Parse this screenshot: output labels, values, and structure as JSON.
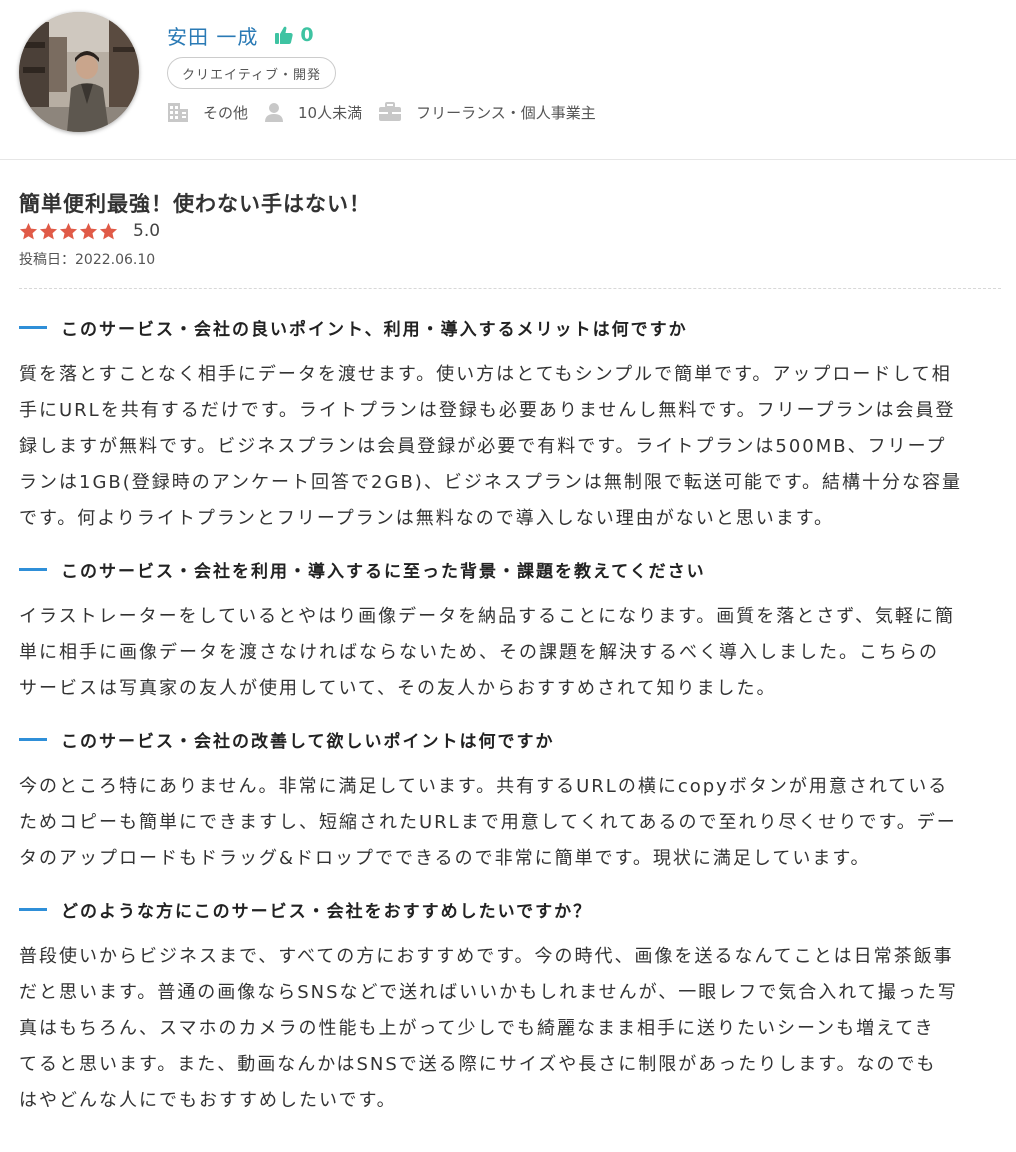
{
  "profile": {
    "name": "安田 一成",
    "like_count": "0",
    "tag": "クリエイティブ・開発",
    "industry": "その他",
    "company_size": "10人未満",
    "occupation": "フリーランス・個人事業主",
    "icons": {
      "like": "thumbs-up-icon",
      "industry": "building-icon",
      "size": "person-icon",
      "occupation": "briefcase-icon"
    },
    "colors": {
      "name": "#2a7ab5",
      "like": "#3ec3a2"
    }
  },
  "review": {
    "title": "簡単便利最強！使わない手はない！",
    "rating_value": "5.0",
    "rating": 5,
    "rating_max": 5,
    "star_color": "#e05a47",
    "post_date": "投稿日：2022.06.10",
    "accent_color": "#2f8fd8",
    "sections": [
      {
        "heading": "このサービス・会社の良いポイント、利用・導入するメリットは何ですか",
        "lines": [
          "質を落とすことなく相手にデータを渡せます。使い方はとてもシンプルで簡単です。アップロードして相",
          "手にURLを共有するだけです。ライトプランは登録も必要ありませんし無料です。フリープランは会員登",
          "録しますが無料です。ビジネスプランは会員登録が必要で有料です。ライトプランは500MB、フリープ",
          "ランは1GB(登録時のアンケート回答で2GB)、ビジネスプランは無制限で転送可能です。結構十分な容量",
          "です。何よりライトプランとフリープランは無料なので導入しない理由がないと思います。"
        ]
      },
      {
        "heading": "このサービス・会社を利用・導入するに至った背景・課題を教えてください",
        "lines": [
          "イラストレーターをしているとやはり画像データを納品することになります。画質を落とさず、気軽に簡",
          "単に相手に画像データを渡さなければならないため、その課題を解決するべく導入しました。こちらの",
          "サービスは写真家の友人が使用していて、その友人からおすすめされて知りました。"
        ]
      },
      {
        "heading": "このサービス・会社の改善して欲しいポイントは何ですか",
        "lines": [
          "今のところ特にありません。非常に満足しています。共有するURLの横にcopyボタンが用意されている",
          "ためコピーも簡単にできますし、短縮されたURLまで用意してくれてあるので至れり尽くせりです。デー",
          "タのアップロードもドラッグ&ドロップでできるので非常に簡単です。現状に満足しています。"
        ]
      },
      {
        "heading": "どのような方にこのサービス・会社をおすすめしたいですか？",
        "lines": [
          "普段使いからビジネスまで、すべての方におすすめです。今の時代、画像を送るなんてことは日常茶飯事",
          "だと思います。普通の画像ならSNSなどで送ればいいかもしれませんが、一眼レフで気合入れて撮った写",
          "真はもちろん、スマホのカメラの性能も上がって少しでも綺麗なまま相手に送りたいシーンも増えてき",
          "てると思います。また、動画なんかはSNSで送る際にサイズや長さに制限があったりします。なのでも",
          "はやどんな人にでもおすすめしたいです。"
        ]
      }
    ]
  }
}
